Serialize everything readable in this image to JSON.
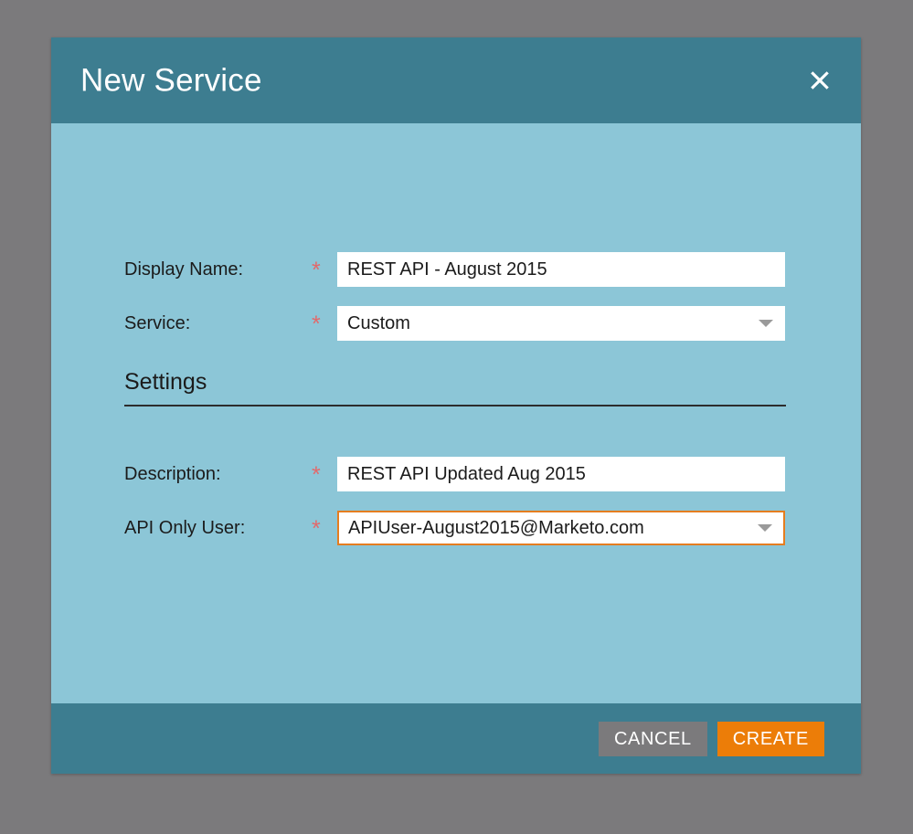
{
  "dialog": {
    "title": "New Service",
    "close_icon": "close-icon",
    "header_color": "#3d7d90",
    "body_color": "#8cc6d7",
    "backdrop_color": "#7b7a7c"
  },
  "form": {
    "required_marker": "*",
    "fields": [
      {
        "label": "Display Name:",
        "required": true,
        "type": "text",
        "value": "REST API - August 2015",
        "placeholder": "",
        "focused": false
      },
      {
        "label": "Service:",
        "required": true,
        "type": "select",
        "value": "Custom",
        "placeholder": "",
        "focused": false
      },
      {
        "label": "Description:",
        "required": true,
        "type": "text",
        "value": "REST API Updated Aug 2015",
        "placeholder": "",
        "focused": false
      },
      {
        "label": "API Only User:",
        "required": true,
        "type": "select",
        "value": "APIUser-August2015@Marketo.com",
        "placeholder": "",
        "focused": true
      }
    ]
  },
  "section": {
    "title": "Settings"
  },
  "footer": {
    "cancel_label": "CANCEL",
    "create_label": "CREATE",
    "cancel_color": "#7b7a7c",
    "create_color": "#ec7d08"
  },
  "colors": {
    "required_star": "#e2696b",
    "focus_border": "#e57d20"
  }
}
